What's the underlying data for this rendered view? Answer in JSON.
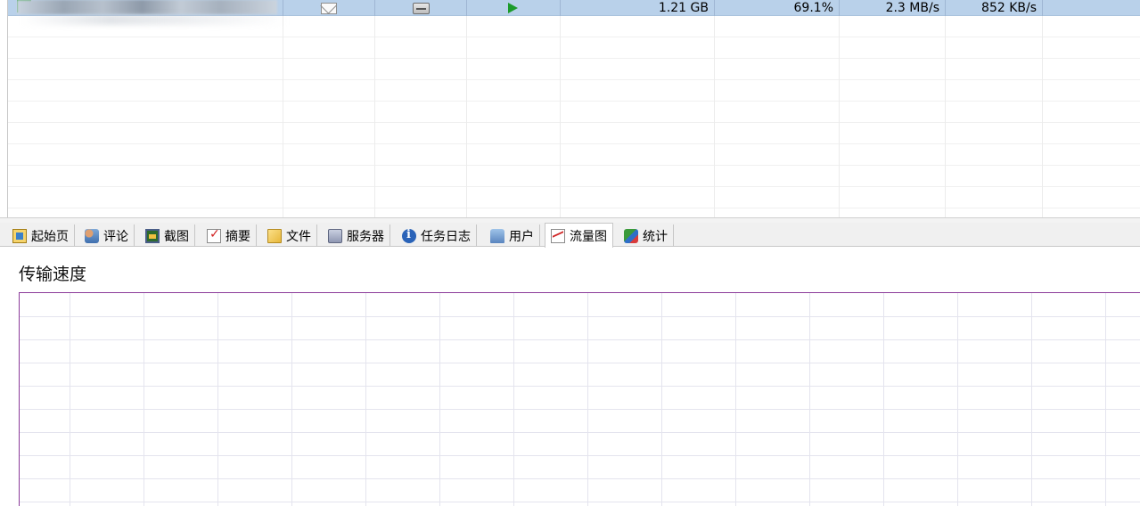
{
  "download_list": {
    "selected_row": {
      "name_blurred": "",
      "icons": [
        "mail-icon",
        "drive-icon",
        "play-icon"
      ],
      "size": "1.21 GB",
      "progress": "69.1%",
      "download_speed": "2.3 MB/s",
      "upload_speed": "852 KB/s"
    }
  },
  "tabs": [
    {
      "label": "起始页",
      "icon": "home-icon"
    },
    {
      "label": "评论",
      "icon": "comment-icon"
    },
    {
      "label": "截图",
      "icon": "screenshot-icon"
    },
    {
      "label": "摘要",
      "icon": "summary-icon"
    },
    {
      "label": "文件",
      "icon": "file-icon"
    },
    {
      "label": "服务器",
      "icon": "server-icon"
    },
    {
      "label": "任务日志",
      "icon": "task-log-icon"
    },
    {
      "label": "用户",
      "icon": "users-icon"
    },
    {
      "label": "流量图",
      "icon": "traffic-chart-icon",
      "active": true
    },
    {
      "label": "统计",
      "icon": "statistics-icon"
    }
  ],
  "traffic_panel": {
    "title": "传输速度"
  },
  "colors": {
    "selected_row": "#b9d1ea",
    "plot_border": "#8b3a9a",
    "grid": "#e4e4ee",
    "play_green": "#1c9b2b"
  }
}
